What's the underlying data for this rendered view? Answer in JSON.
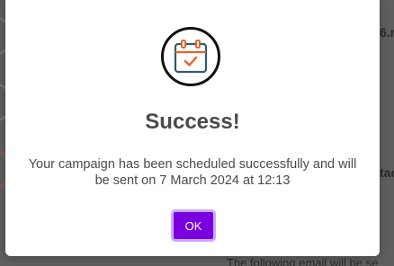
{
  "modal": {
    "title": "Success!",
    "message": "Your campaign has been scheduled successfully and will be sent on 7 March 2024 at 12:13",
    "ok_label": "OK",
    "icon": "calendar-check-icon",
    "colors": {
      "accent": "#7b00e0",
      "icon_check": "#e8632b",
      "icon_body": "#2f5c72"
    }
  },
  "background": {
    "right_text_1": "6.r",
    "right_text_2": "tac",
    "bottom_text": "The following email will be se"
  }
}
